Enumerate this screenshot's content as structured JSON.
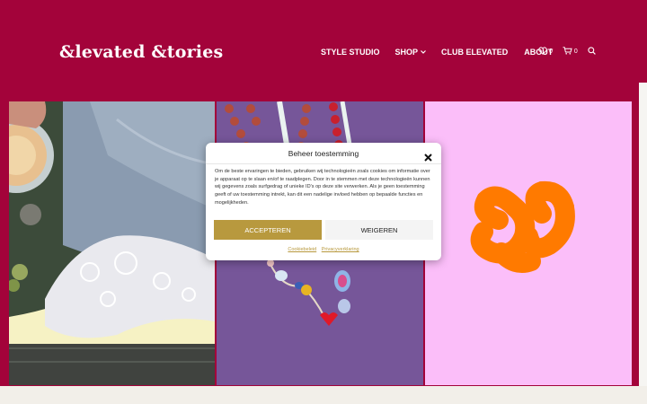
{
  "brand": {
    "logo_text": "&levated &tories"
  },
  "nav": {
    "items": [
      {
        "label": "STYLE STUDIO"
      },
      {
        "label": "SHOP"
      },
      {
        "label": "CLUB ELEVATED"
      },
      {
        "label": "ABOUT"
      }
    ]
  },
  "header_icons": {
    "wishlist_count": "0",
    "cart_count": "0",
    "icons": [
      "heart-icon",
      "cart-icon",
      "search-icon"
    ]
  },
  "colors": {
    "brand": "#a3033a",
    "accent": "#b8993e",
    "panel_pink": "#fbbef9",
    "logo_orange": "#ff7a00"
  },
  "consent": {
    "title": "Beheer toestemming",
    "body": "Om de beste ervaringen te bieden, gebruiken wij technologieën zoals cookies om informatie over je apparaat op te slaan en/of te raadplegen. Door in te stemmen met deze technologieën kunnen wij gegevens zoals surfgedrag of unieke ID's op deze site verwerken. Als je geen toestemming geeft of uw toestemming intrekt, kan dit een nadelige invloed hebben op bepaalde functies en mogelijkheden.",
    "accept_label": "ACCEPTEREN",
    "deny_label": "WEIGEREN",
    "links": [
      "Cookiebeleid",
      "Privacyverklaring"
    ]
  }
}
